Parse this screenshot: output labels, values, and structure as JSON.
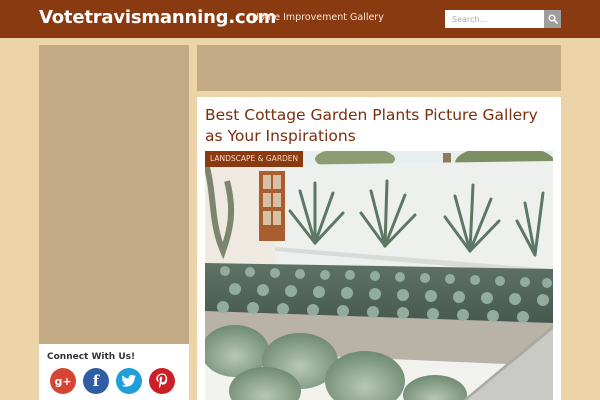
{
  "header": {
    "site_title": "Votetravismanning.com",
    "nav_link": "Home Improvement Gallery",
    "search_placeholder": "Search...",
    "search_icon": "search-icon"
  },
  "sidebar": {
    "connect_title": "Connect With Us!",
    "social": [
      {
        "name": "google-plus",
        "glyph": "g+",
        "color": "#d64533"
      },
      {
        "name": "facebook",
        "glyph": "f",
        "color": "#2f5ea3"
      },
      {
        "name": "twitter",
        "glyph": "t",
        "color": "#1f9fd8"
      },
      {
        "name": "pinterest",
        "glyph": "p",
        "color": "#cb2027"
      }
    ]
  },
  "article": {
    "title": "Best Cottage Garden Plants Picture Gallery as Your Inspirations",
    "category": "LANDSCAPE & GARDEN",
    "image_icon": "garden-photo"
  },
  "colors": {
    "header_bg": "#8a3a11",
    "page_bg": "#ecd4a8",
    "panel_bg": "#c2aa84",
    "title_color": "#7a2e0d"
  }
}
